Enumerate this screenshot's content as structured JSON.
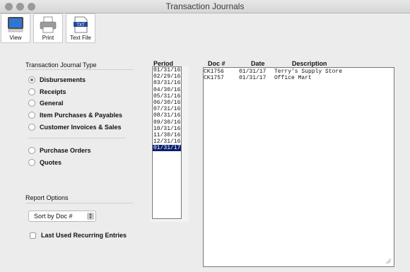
{
  "window": {
    "title": "Transaction Journals"
  },
  "toolbar": {
    "view_label": "View",
    "print_label": "Print",
    "textfile_label": "Text File",
    "textfile_icon_text": "TXT"
  },
  "journal_type": {
    "title": "Transaction Journal Type",
    "options": [
      {
        "label": "Disbursements",
        "selected": true
      },
      {
        "label": "Receipts",
        "selected": false
      },
      {
        "label": "General",
        "selected": false
      },
      {
        "label": "Item Purchases & Payables",
        "selected": false
      },
      {
        "label": "Customer Invoices & Sales",
        "selected": false
      },
      {
        "label": "Purchase Orders",
        "selected": false
      },
      {
        "label": "Quotes",
        "selected": false
      }
    ]
  },
  "report_options": {
    "title": "Report Options",
    "sort_value": "Sort by Doc #",
    "recurring_label": "Last Used Recurring Entries",
    "recurring_checked": false
  },
  "period": {
    "header": "Period",
    "items": [
      "01/31/16",
      "02/29/16",
      "03/31/16",
      "04/30/16",
      "05/31/16",
      "06/30/16",
      "07/31/16",
      "08/31/16",
      "09/30/16",
      "10/31/16",
      "11/30/16",
      "12/31/16",
      "01/31/17"
    ],
    "selected_index": 12
  },
  "documents": {
    "headers": {
      "doc": "Doc #",
      "date": "Date",
      "description": "Description"
    },
    "rows": [
      {
        "doc": "CK1756",
        "date": "01/31/17",
        "description": "Terry's Supply Store"
      },
      {
        "doc": "CK1757",
        "date": "01/31/17",
        "description": "Office Mart"
      }
    ]
  }
}
